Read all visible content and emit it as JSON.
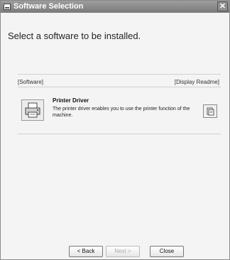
{
  "window": {
    "title": "Software Selection"
  },
  "heading": "Select a software to be installed.",
  "columns": {
    "left": "[Software]",
    "right": "[Display Readme]"
  },
  "software_items": [
    {
      "title": "Printer Driver",
      "description": "The printer driver enables you to use the printer function of the machine."
    }
  ],
  "buttons": {
    "back": "< Back",
    "next": "Next >",
    "close": "Close"
  }
}
